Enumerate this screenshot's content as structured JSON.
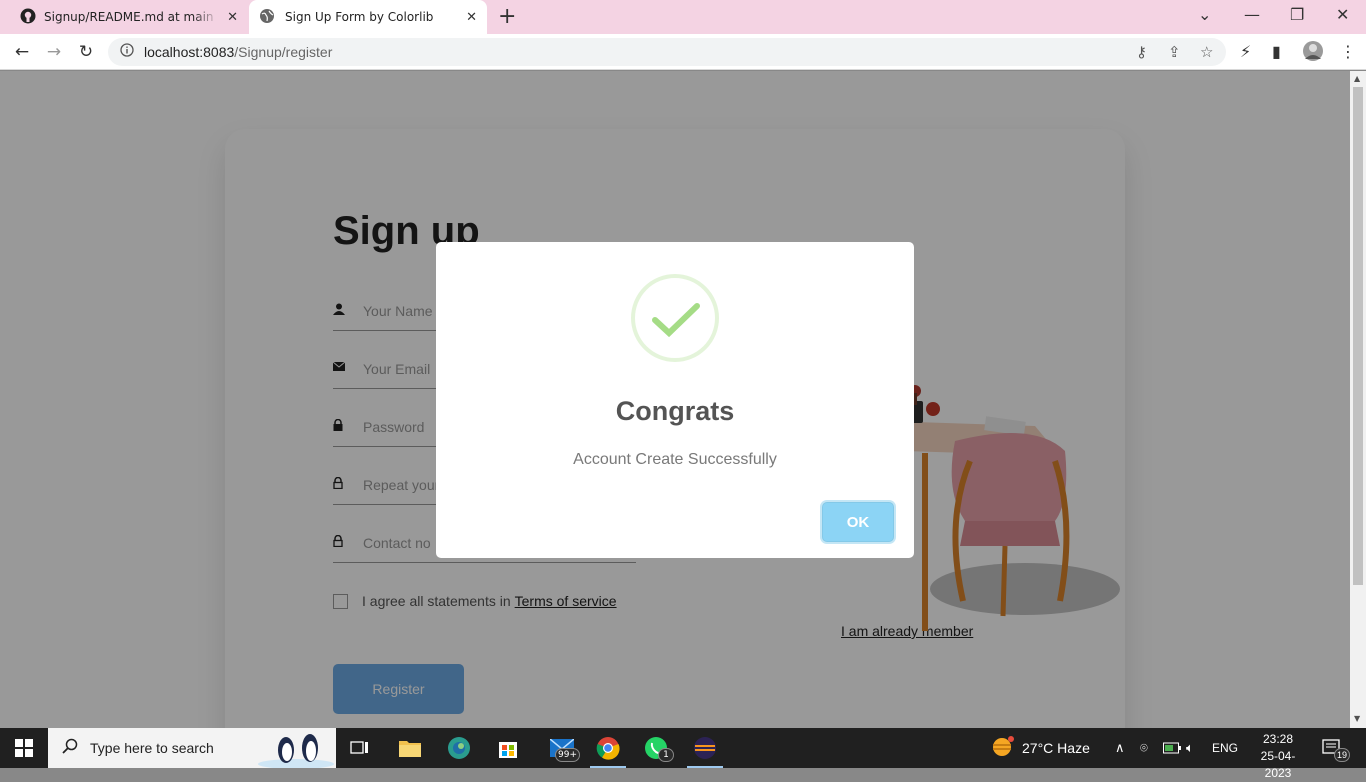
{
  "browser": {
    "tabs": [
      {
        "title": "Signup/README.md at main · co",
        "icon": "github-icon",
        "active": false
      },
      {
        "title": "Sign Up Form by Colorlib",
        "icon": "globe-icon",
        "active": true
      }
    ],
    "address": {
      "host": "localhost:8083",
      "path": "/Signup/register"
    }
  },
  "form": {
    "title": "Sign up",
    "fields": [
      {
        "placeholder": "Your Name",
        "icon": "user-icon"
      },
      {
        "placeholder": "Your Email",
        "icon": "email-icon"
      },
      {
        "placeholder": "Password",
        "icon": "lock-icon"
      },
      {
        "placeholder": "Repeat your password",
        "icon": "lock-outline-icon"
      },
      {
        "placeholder": "Contact no",
        "icon": "lock-outline-icon"
      }
    ],
    "agree_text": "I agree all statements in",
    "terms_link": "Terms of service",
    "register_label": "Register",
    "member_link": "I am already member"
  },
  "modal": {
    "title": "Congrats",
    "text": "Account Create Successfully",
    "ok_label": "OK",
    "icon": "success-check-icon"
  },
  "taskbar": {
    "search_placeholder": "Type here to search",
    "mail_badge": "99+",
    "whatsapp_badge": "1",
    "weather": "27°C  Haze",
    "language": "ENG",
    "time": "23:28",
    "date": "25-04-2023",
    "notification_count": "19"
  },
  "colors": {
    "accent": "#6dabe4",
    "ok_button": "#8cd4f5",
    "success_green": "#a5dc86",
    "tabbar": "#f4d3e3"
  }
}
